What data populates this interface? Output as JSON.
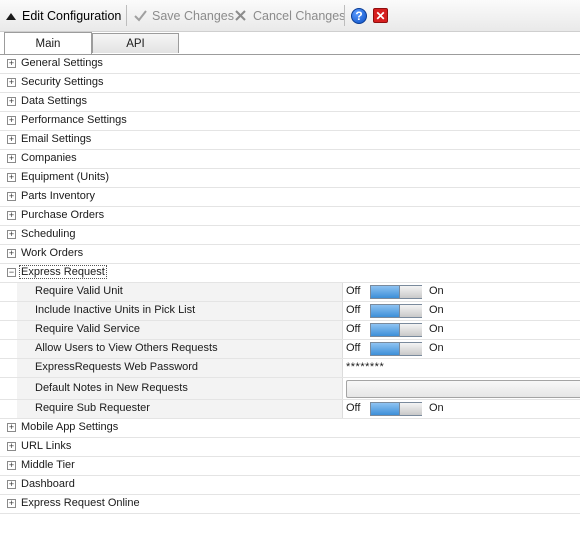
{
  "toolbar": {
    "edit_config": "Edit Configuration",
    "save_changes": "Save Changes",
    "cancel_changes": "Cancel Changes",
    "help_glyph": "?",
    "close_glyph": "✕"
  },
  "tabs": [
    {
      "label": "Main",
      "active": true
    },
    {
      "label": "API",
      "active": false
    }
  ],
  "tree": {
    "groups_before": [
      "General Settings",
      "Security Settings",
      "Data Settings",
      "Performance Settings",
      "Email Settings",
      "Companies",
      "Equipment (Units)",
      "Parts Inventory",
      "Purchase Orders",
      "Scheduling",
      "Work Orders"
    ],
    "expanded_group": "Express Request",
    "properties": [
      {
        "name": "Require Valid Unit",
        "type": "toggle",
        "off": "Off",
        "on": "On",
        "value": "Off"
      },
      {
        "name": "Include Inactive Units in Pick List",
        "type": "toggle",
        "off": "Off",
        "on": "On",
        "value": "Off"
      },
      {
        "name": "Require Valid Service",
        "type": "toggle",
        "off": "Off",
        "on": "On",
        "value": "Off"
      },
      {
        "name": "Allow Users to View Others Requests",
        "type": "toggle",
        "off": "Off",
        "on": "On",
        "value": "Off"
      },
      {
        "name": "ExpressRequests Web Password",
        "type": "password",
        "value": "********"
      },
      {
        "name": "Default Notes in New Requests",
        "type": "text",
        "value": ""
      },
      {
        "name": "Require Sub Requester",
        "type": "toggle",
        "off": "Off",
        "on": "On",
        "value": "Off"
      }
    ],
    "groups_after": [
      "Mobile App Settings",
      "URL Links",
      "Middle Tier",
      "Dashboard",
      "Express Request Online"
    ],
    "collapsed_glyph": "+",
    "expanded_glyph": "−"
  },
  "colors": {
    "toggle_fill": "#3d8fd8",
    "toolbar_bg": "#e9e9e9"
  }
}
